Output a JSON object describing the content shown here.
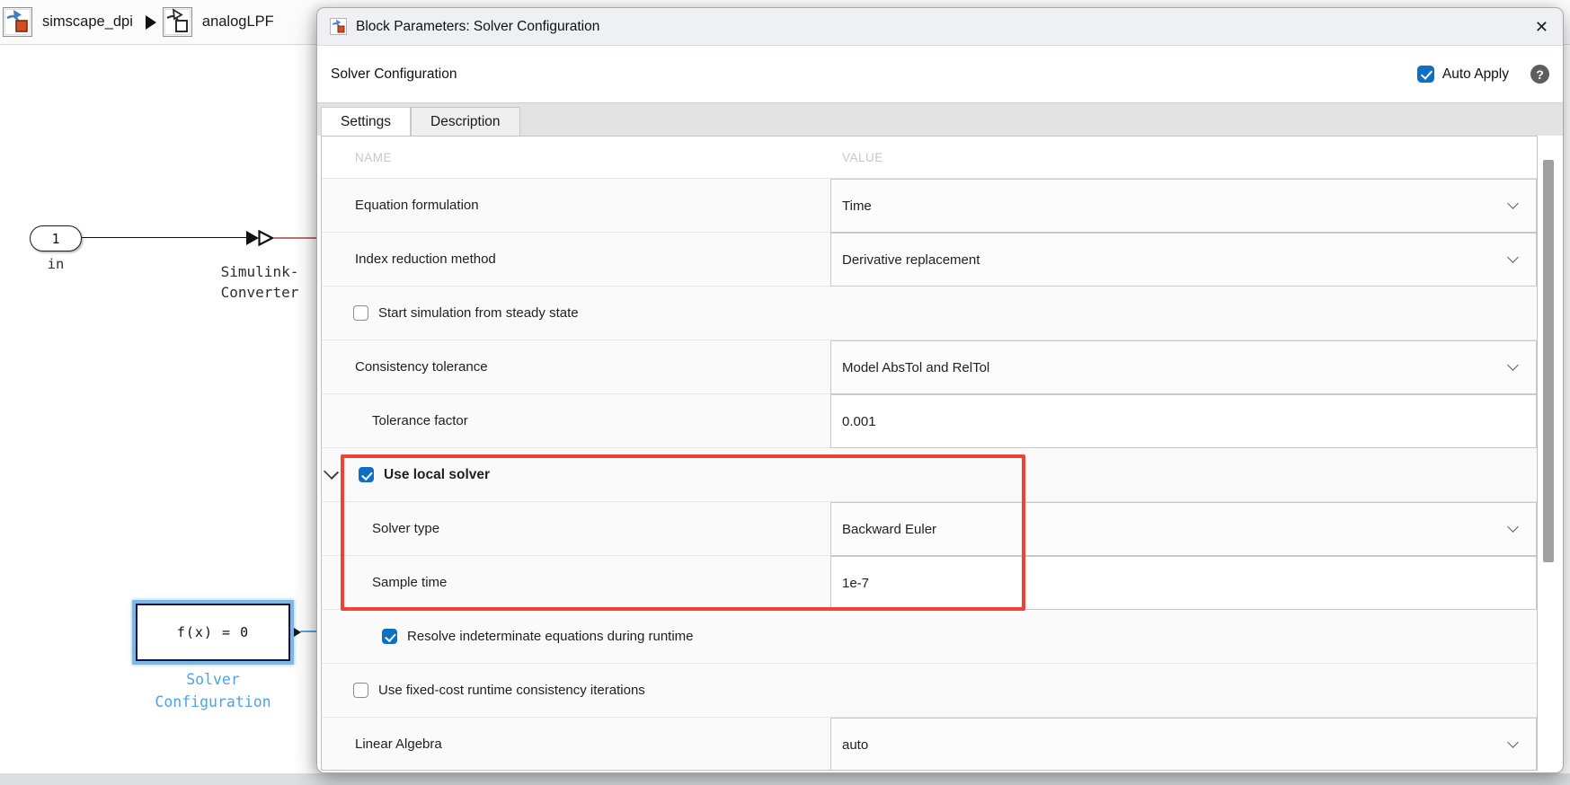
{
  "breadcrumb": {
    "items": [
      {
        "label": "simscape_dpi",
        "icon": "simulink-model-icon"
      },
      {
        "label": "analogLPF",
        "icon": "subsystem-icon"
      }
    ]
  },
  "model": {
    "inport": {
      "number": "1",
      "label": "in"
    },
    "converter_label_line1": "Simulink-",
    "converter_label_line2": "Converter",
    "solver_block": {
      "text": "f(x) = 0",
      "label_line1": "Solver",
      "label_line2": "Configuration"
    }
  },
  "dialog": {
    "title": "Block Parameters: Solver Configuration",
    "subtitle": "Solver Configuration",
    "auto_apply_label": "Auto Apply",
    "auto_apply_checked": true,
    "close_icon": "✕",
    "help_icon": "?",
    "tabs": [
      {
        "label": "Settings",
        "active": true
      },
      {
        "label": "Description",
        "active": false
      }
    ],
    "table": {
      "name_header": "NAME",
      "value_header": "VALUE",
      "rows": [
        {
          "type": "dropdown",
          "label": "Equation formulation",
          "value": "Time",
          "indent": 0
        },
        {
          "type": "dropdown",
          "label": "Index reduction method",
          "value": "Derivative replacement",
          "indent": 0
        },
        {
          "type": "checkbox",
          "label": "Start simulation from steady state",
          "checked": false,
          "indent": 0
        },
        {
          "type": "dropdown",
          "label": "Consistency tolerance",
          "value": "Model AbsTol and RelTol",
          "indent": 0
        },
        {
          "type": "text",
          "label": "Tolerance factor",
          "value": "0.001",
          "indent": 1
        },
        {
          "type": "checkbox",
          "label": "Use local solver",
          "checked": true,
          "bold": true,
          "expander": true,
          "indent": 0
        },
        {
          "type": "dropdown",
          "label": "Solver type",
          "value": "Backward Euler",
          "indent": 1
        },
        {
          "type": "text",
          "label": "Sample time",
          "value": "1e-7",
          "indent": 1
        },
        {
          "type": "checkbox",
          "label": "Resolve indeterminate equations during runtime",
          "checked": true,
          "indent": 1
        },
        {
          "type": "checkbox",
          "label": "Use fixed-cost runtime consistency iterations",
          "checked": false,
          "indent": 0
        },
        {
          "type": "dropdown",
          "label": "Linear Algebra",
          "value": "auto",
          "indent": 0
        }
      ]
    },
    "annotation_color": "#ef4136",
    "accent_color": "#0e6fc4"
  }
}
